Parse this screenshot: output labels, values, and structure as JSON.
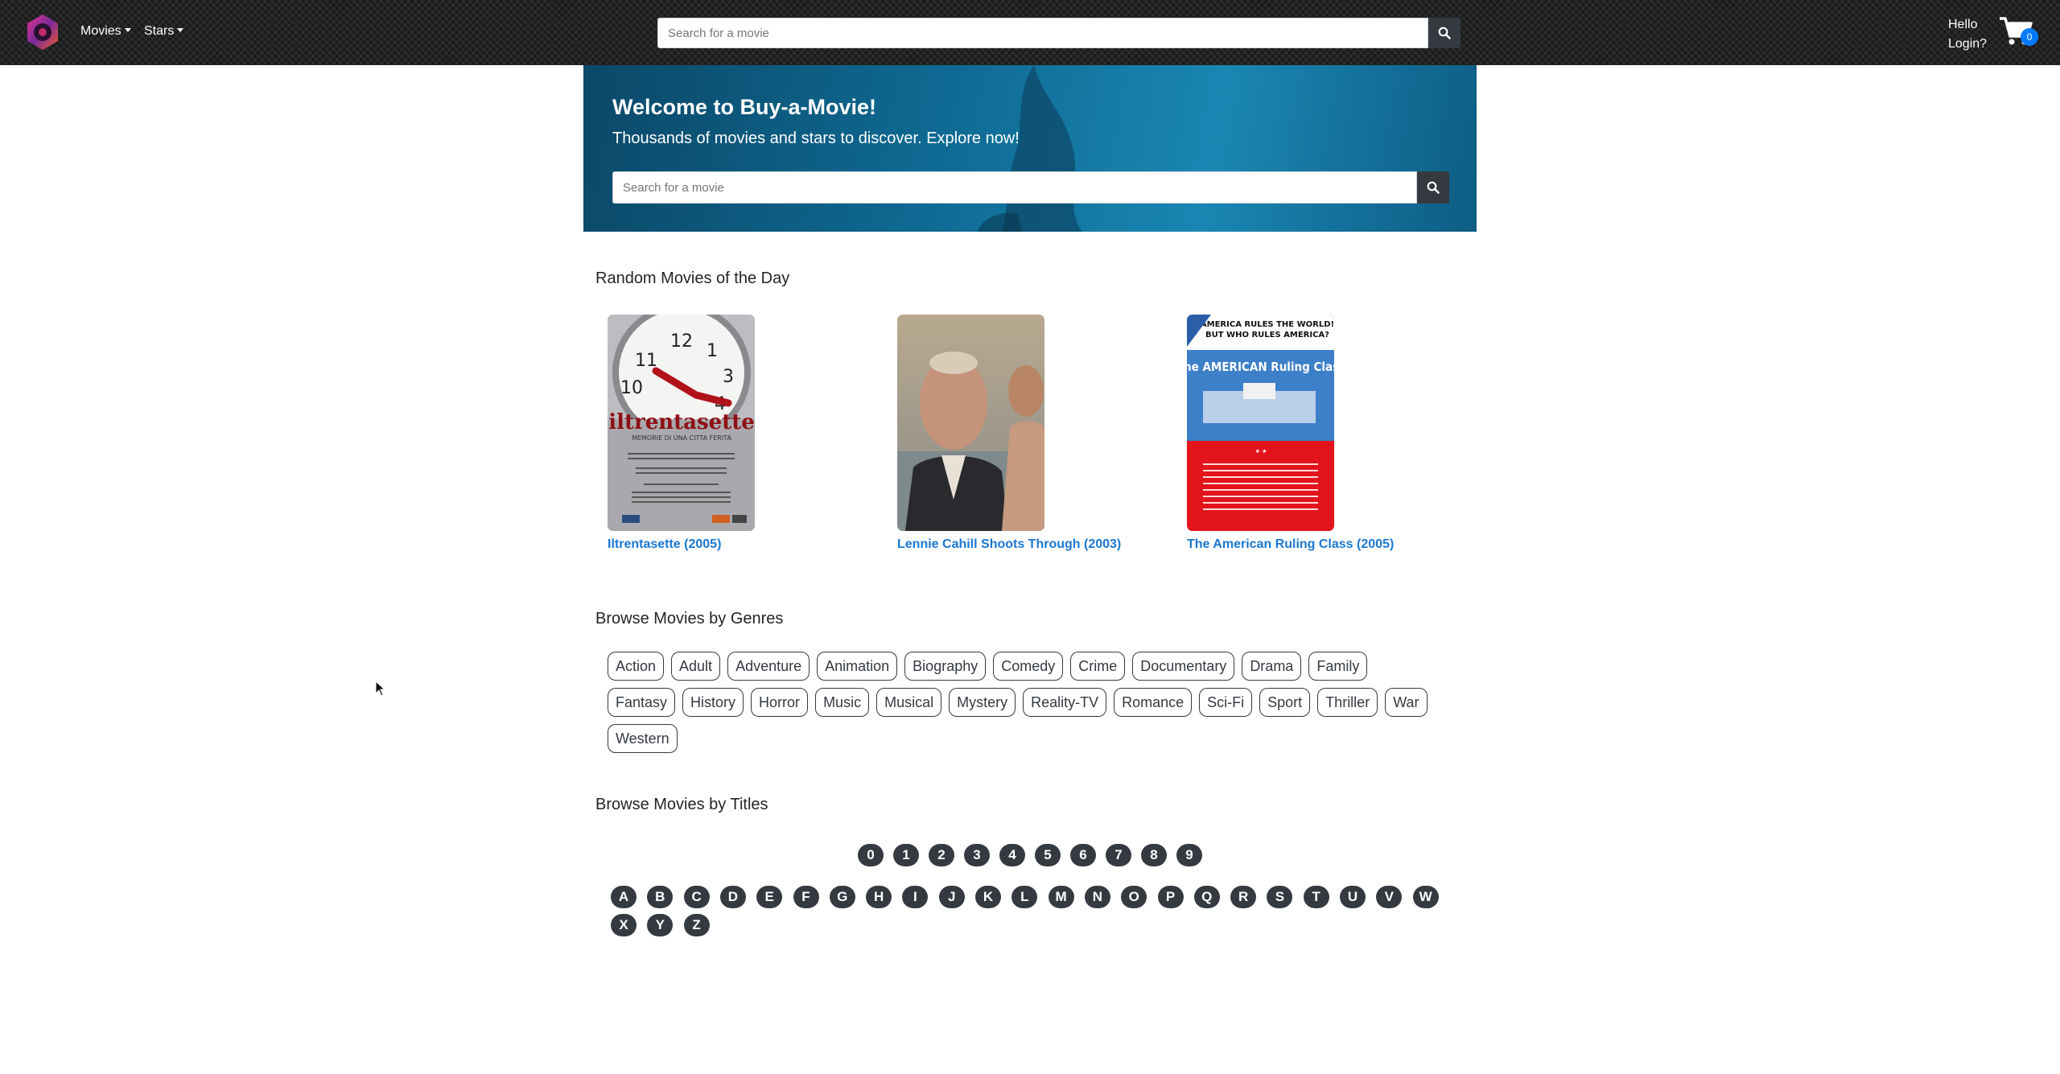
{
  "nav": {
    "movies_label": "Movies",
    "stars_label": "Stars",
    "search_placeholder": "Search for a movie",
    "hello_text": "Hello",
    "login_text": "Login?",
    "cart_count": "0"
  },
  "hero": {
    "title": "Welcome to Buy-a-Movie!",
    "subtitle": "Thousands of movies and stars to discover. Explore now!",
    "search_placeholder": "Search for a movie"
  },
  "random": {
    "title": "Random Movies of the Day",
    "movies": [
      {
        "title": "Iltrentasette (2005)",
        "poster_text": "iltrentasette",
        "poster_sub": "MEMORIE DI UNA CITTA FERITA"
      },
      {
        "title": "Lennie Cahill Shoots Through (2003)"
      },
      {
        "title": "The American Ruling Class (2005)",
        "poster_tag1": "AMERICA RULES THE WORLD!",
        "poster_tag2": "BUT WHO RULES AMERICA?",
        "poster_title": "The AMERICAN Ruling Class"
      }
    ]
  },
  "genres": {
    "title": "Browse Movies by Genres",
    "rows": [
      [
        "Action",
        "Adult",
        "Adventure",
        "Animation",
        "Biography",
        "Comedy",
        "Crime",
        "Documentary",
        "Drama",
        "Family"
      ],
      [
        "Fantasy",
        "History",
        "Horror",
        "Music",
        "Musical",
        "Mystery",
        "Reality-TV",
        "Romance",
        "Sci-Fi",
        "Sport",
        "Thriller",
        "War"
      ],
      [
        "Western"
      ]
    ]
  },
  "titles": {
    "title": "Browse Movies by Titles",
    "digits": [
      "0",
      "1",
      "2",
      "3",
      "4",
      "5",
      "6",
      "7",
      "8",
      "9"
    ],
    "letters_row1": [
      "A",
      "B",
      "C",
      "D",
      "E",
      "F",
      "G",
      "H",
      "I",
      "J",
      "K",
      "L",
      "M",
      "N",
      "O",
      "P",
      "Q",
      "R",
      "S",
      "T",
      "U",
      "V",
      "W"
    ],
    "letters_row2": [
      "X",
      "Y",
      "Z"
    ]
  },
  "colors": {
    "navbar_bg": "#1b1b1b",
    "link": "#1b78d2",
    "pill_bg": "#343a40",
    "badge": "#007bff"
  }
}
